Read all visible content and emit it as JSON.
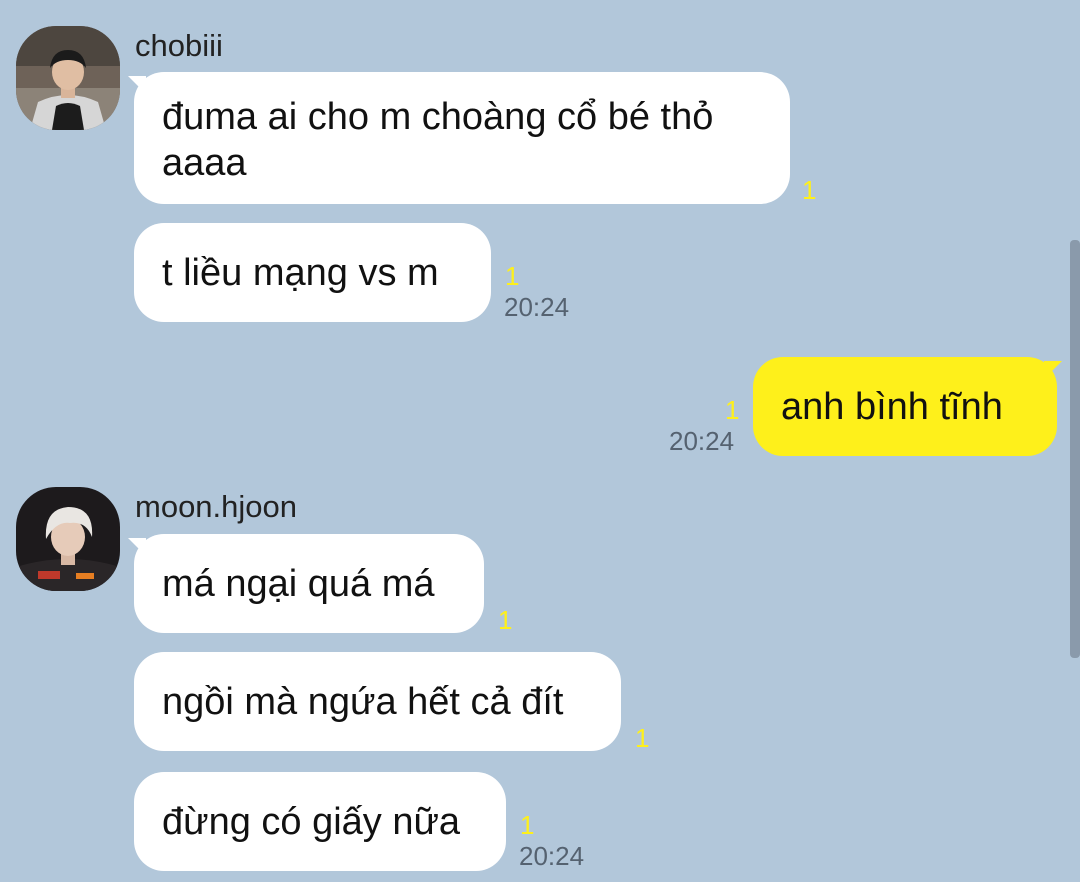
{
  "theme": {
    "background": "#b2c7da",
    "incoming_bubble": "#ffffff",
    "outgoing_bubble": "#fef01b",
    "unread_color": "#fef01b",
    "time_color": "#556270"
  },
  "conversation": [
    {
      "sender": "chobiii",
      "avatar_icon": "profile-photo-icon",
      "messages": [
        {
          "text": "đuma ai cho m choàng cổ bé thỏ aaaa",
          "unread": "1"
        },
        {
          "text": "t liều mạng vs m",
          "unread": "1",
          "time": "20:24"
        }
      ]
    },
    {
      "sender": "me",
      "messages": [
        {
          "text": "anh bình tĩnh",
          "unread": "1",
          "time": "20:24"
        }
      ]
    },
    {
      "sender": "moon.hjoon",
      "avatar_icon": "profile-photo-icon",
      "messages": [
        {
          "text": "má ngại quá má",
          "unread": "1"
        },
        {
          "text": "ngồi mà ngứa hết cả đít",
          "unread": "1"
        },
        {
          "text": "đừng có giấy nữa",
          "unread": "1",
          "time": "20:24"
        }
      ]
    }
  ]
}
